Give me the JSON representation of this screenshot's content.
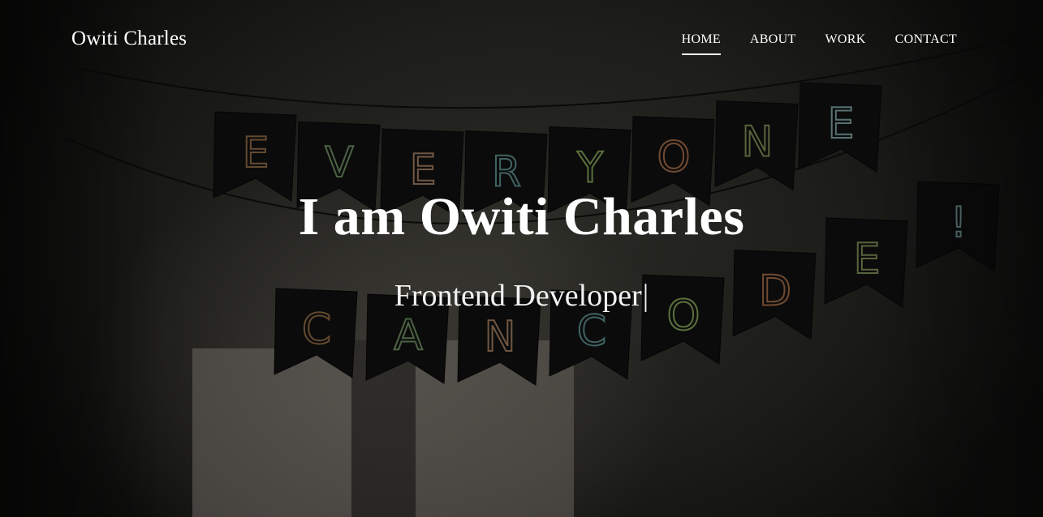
{
  "header": {
    "brand": "Owiti Charles",
    "nav": [
      {
        "label": "HOME",
        "active": true
      },
      {
        "label": "ABOUT",
        "active": false
      },
      {
        "label": "WORK",
        "active": false
      },
      {
        "label": "CONTACT",
        "active": false
      }
    ]
  },
  "hero": {
    "title": "I am Owiti Charles",
    "subtitle": "Frontend Developer",
    "cursor": "|",
    "banner_top_letters": [
      "E",
      "V",
      "E",
      "R",
      "Y",
      "O",
      "N",
      "E"
    ],
    "banner_bottom_letters": [
      "C",
      "A",
      "N",
      "C",
      "O",
      "D",
      "E",
      "!"
    ],
    "banner_letter_colors": [
      "#7a5a3a",
      "#5c7a52",
      "#8a6a52",
      "#4e7a78",
      "#6f8a4a",
      "#8a5a3a",
      "#6a7a4a",
      "#6a8a8a"
    ]
  }
}
